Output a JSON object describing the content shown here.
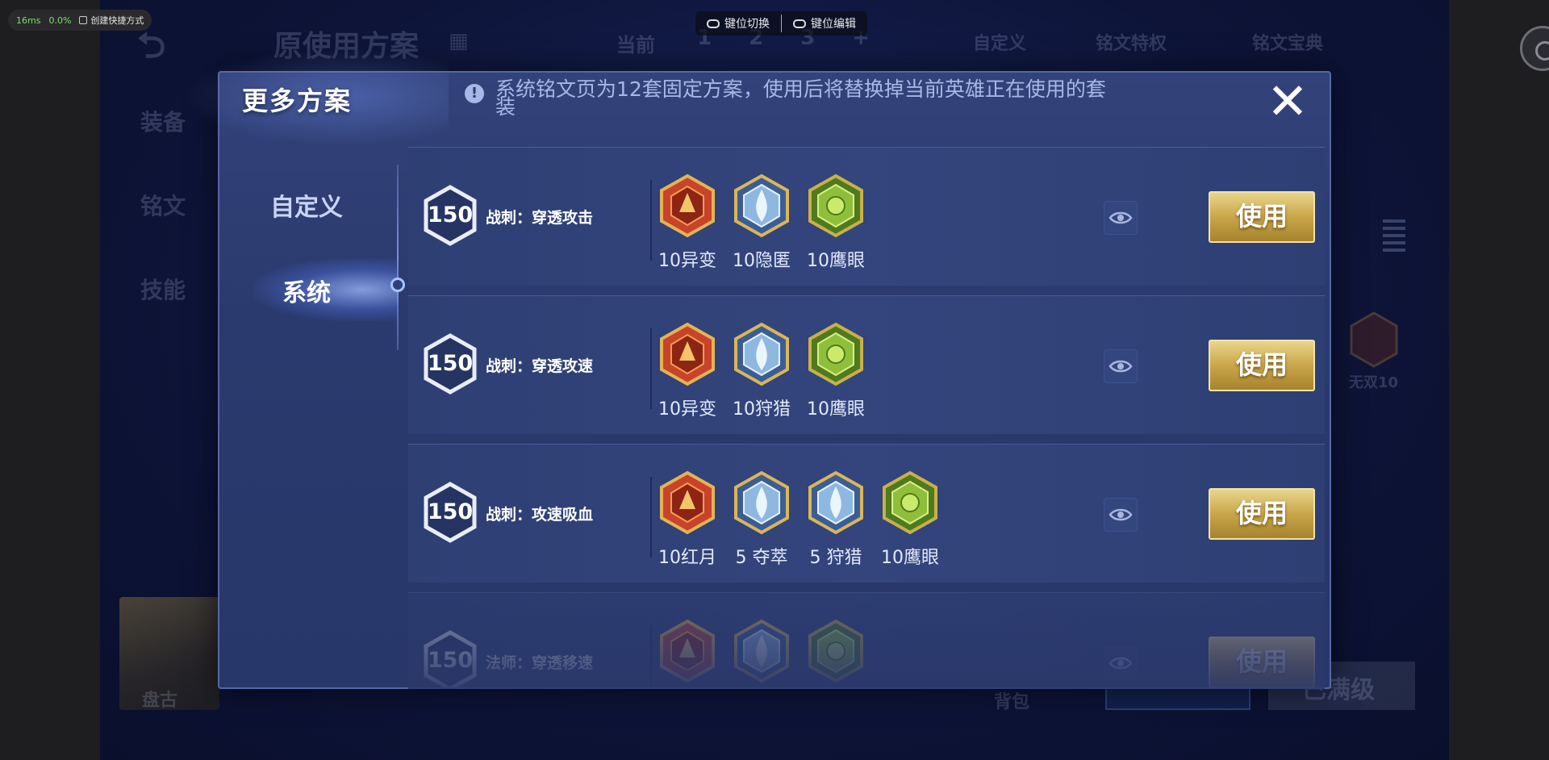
{
  "overlay": {
    "latency": "16ms",
    "percent": "0.0%",
    "shortcut": "创建快捷方式",
    "key_switch": "键位切换",
    "key_edit": "键位编辑"
  },
  "background": {
    "title": "原使用方案",
    "current": "当前",
    "tabs": [
      "1",
      "2",
      "3",
      "+"
    ],
    "custom": "自定义",
    "privilege": "铭文特权",
    "codex": "铭文宝典",
    "side": [
      "装备",
      "铭文",
      "技能"
    ],
    "hero": "盘古",
    "bag": "背包",
    "maxed": "已满级",
    "rune_side_label": "无双10"
  },
  "modal": {
    "title": "更多方案",
    "notice": "系统铭文页为12套固定方案，使用后将替换掉当前英雄正在使用的套装",
    "close": "✕",
    "nav": {
      "custom": "自定义",
      "system": "系统"
    },
    "use_label": "使用",
    "rows": [
      {
        "level": "150",
        "name": "战刺：穿透攻击",
        "runes": [
          {
            "label": "10异变",
            "kind": "red"
          },
          {
            "label": "10隐匿",
            "kind": "blue"
          },
          {
            "label": "10鹰眼",
            "kind": "green"
          }
        ]
      },
      {
        "level": "150",
        "name": "战刺：穿透攻速",
        "runes": [
          {
            "label": "10异变",
            "kind": "red"
          },
          {
            "label": "10狩猎",
            "kind": "blue"
          },
          {
            "label": "10鹰眼",
            "kind": "green"
          }
        ]
      },
      {
        "level": "150",
        "name": "战刺：攻速吸血",
        "runes": [
          {
            "label": "10红月",
            "kind": "red"
          },
          {
            "label": "5 夺萃",
            "kind": "blue"
          },
          {
            "label": "5 狩猎",
            "kind": "blue"
          },
          {
            "label": "10鹰眼",
            "kind": "green"
          }
        ]
      },
      {
        "level": "150",
        "name": "法师：穿透移速",
        "runes": [
          {
            "label": "",
            "kind": "red"
          },
          {
            "label": "",
            "kind": "blue"
          },
          {
            "label": "",
            "kind": "green"
          }
        ]
      }
    ]
  },
  "colors": {
    "rune_red": "#c8432a",
    "rune_blue": "#8fb8e0",
    "rune_green": "#8fbf3a",
    "gold": "#c9a64a"
  }
}
